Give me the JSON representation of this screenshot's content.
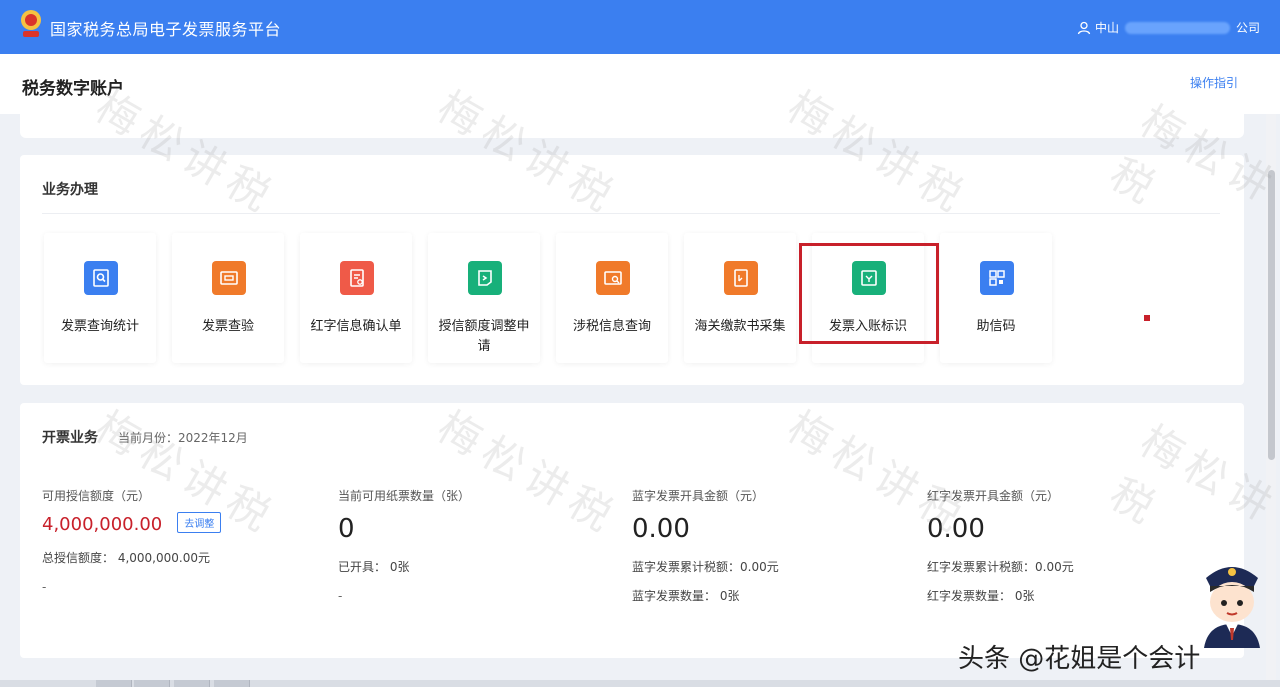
{
  "header": {
    "app_title": "国家税务总局电子发票服务平台",
    "user_prefix": "中山",
    "user_suffix": "公司",
    "user_icon": "user-icon"
  },
  "subheader": {
    "title": "税务数字账户",
    "help_link": "操作指引"
  },
  "biz": {
    "title": "业务办理",
    "tiles": [
      {
        "label": "发票查询统计",
        "color": "#3b7ff0",
        "icon": "invoice-search-icon"
      },
      {
        "label": "发票查验",
        "color": "#f07a2a",
        "icon": "invoice-verify-icon"
      },
      {
        "label": "红字信息确认单",
        "color": "#ef5a48",
        "icon": "red-letter-icon"
      },
      {
        "label": "授信额度调整申请",
        "color": "#18b07a",
        "icon": "credit-adjust-icon"
      },
      {
        "label": "涉税信息查询",
        "color": "#f07a2a",
        "icon": "tax-info-icon"
      },
      {
        "label": "海关缴款书采集",
        "color": "#f07a2a",
        "icon": "customs-doc-icon"
      },
      {
        "label": "发票入账标识",
        "color": "#18b07a",
        "icon": "invoice-ledger-icon"
      },
      {
        "label": "助信码",
        "color": "#3b7ff0",
        "icon": "qr-code-icon"
      }
    ]
  },
  "invoicing": {
    "title": "开票业务",
    "period": "当前月份：2022年12月",
    "credit": {
      "label": "可用授信额度（元）",
      "value": "4,000,000.00",
      "button": "去调整",
      "total": "总授信额度：  4,000,000.00元",
      "dash": "-"
    },
    "paper": {
      "label": "当前可用纸票数量（张）",
      "value": "0",
      "issued": "已开具：  0张",
      "dash": "-"
    },
    "blue": {
      "label": "蓝字发票开具金额（元）",
      "value": "0.00",
      "tax": "蓝字发票累计税额：0.00元",
      "count": "蓝字发票数量：  0张"
    },
    "red": {
      "label": "红字发票开具金额（元）",
      "value": "0.00",
      "tax": "红字发票累计税额：0.00元",
      "count": "红字发票数量：  0张"
    }
  },
  "watermark_text": "梅松讲税",
  "source_tag": "头条 @花姐是个会计",
  "colors": {
    "topbar": "#3b7ff0",
    "highlight": "#c8202a",
    "credit_value": "#c8202a"
  }
}
